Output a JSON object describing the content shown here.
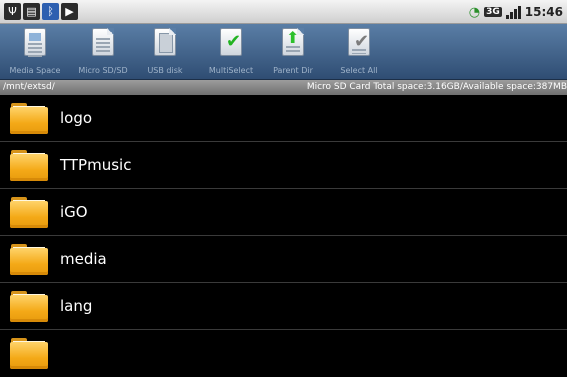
{
  "status_bar": {
    "left_icons": [
      "usb-icon",
      "storage-icon",
      "bluetooth-icon",
      "media-play-icon"
    ],
    "right_icons": [
      "gps-icon",
      "3g-icon",
      "signal-icon"
    ],
    "network_label": "3G",
    "time": "15:46"
  },
  "toolbar": {
    "buttons": [
      {
        "label": "Media Space",
        "icon": "media-space-icon"
      },
      {
        "label": "Micro SD/SD",
        "icon": "sd-card-icon"
      },
      {
        "label": "USB disk",
        "icon": "usb-disk-icon"
      },
      {
        "label": "MultiSelect",
        "icon": "multiselect-icon"
      },
      {
        "label": "Parent Dir",
        "icon": "parent-dir-icon"
      },
      {
        "label": "Select All",
        "icon": "select-all-icon"
      }
    ]
  },
  "path_bar": {
    "path": "/mnt/extsd/",
    "space_info": "Micro SD Card Total space:3.16GB/Available space:387MB"
  },
  "files": [
    {
      "name": "logo"
    },
    {
      "name": "TTPmusic"
    },
    {
      "name": "iGO"
    },
    {
      "name": "media"
    },
    {
      "name": "lang"
    }
  ]
}
